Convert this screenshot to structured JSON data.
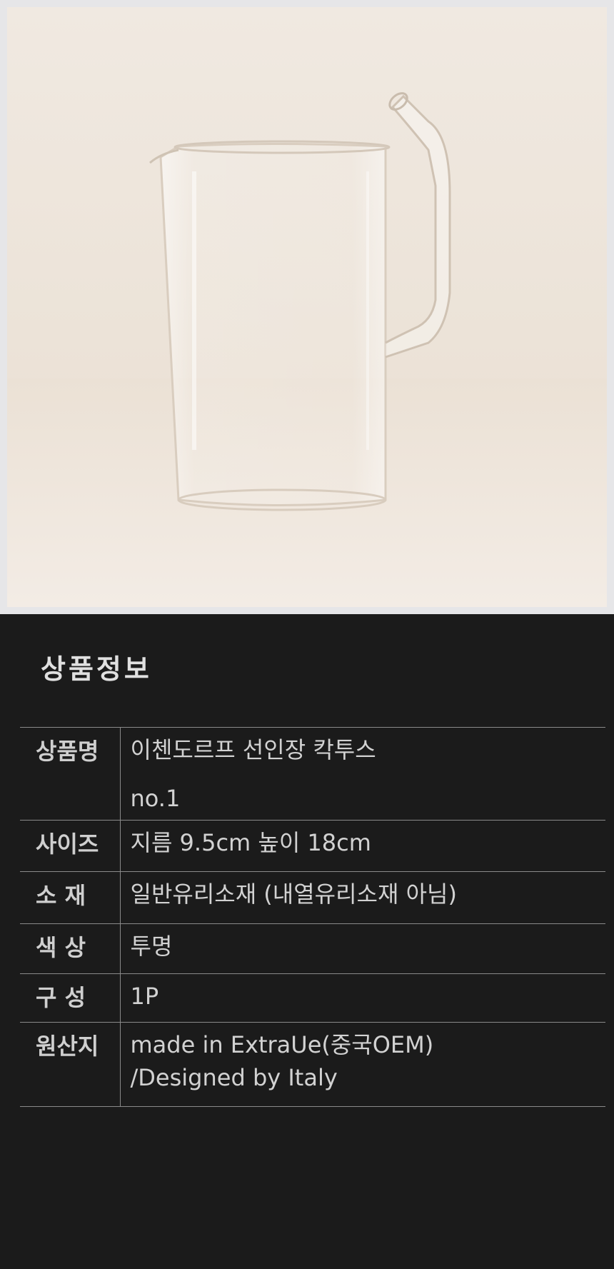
{
  "product_image": {
    "alt": "glass-pitcher-photo",
    "colors": {
      "frame": "#e6e6e8",
      "backdrop": "#efe7dd"
    }
  },
  "section_title": "상품정보",
  "spec_rows": [
    {
      "label": "상품명",
      "value_lines": [
        "이첸도르프 선인장 칵투스",
        "no.1"
      ]
    },
    {
      "label": "사이즈",
      "value_lines": [
        "지름 9.5cm 높이 18cm"
      ]
    },
    {
      "label": "소 재",
      "value_lines": [
        "일반유리소재 (내열유리소재 아님)"
      ]
    },
    {
      "label": "색 상",
      "value_lines": [
        "투명"
      ]
    },
    {
      "label": "구 성",
      "value_lines": [
        "1P"
      ]
    },
    {
      "label": "원산지",
      "value_lines": [
        "made in ExtraUe(중국OEM)",
        "/Designed by Italy"
      ]
    }
  ]
}
